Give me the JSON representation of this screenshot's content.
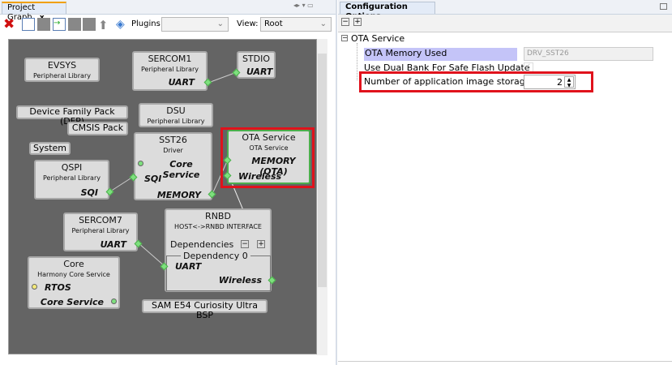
{
  "left_panel": {
    "tab": "Project Graph",
    "close": "x",
    "plugins_label": "Plugins:",
    "plugins_value": "",
    "view_label": "View:",
    "view_value": "Root",
    "toolbar": [
      "delete-icon",
      "add-component-icon",
      "component-icon",
      "import-icon",
      "component-icon",
      "component-icon",
      "up-arrow-icon",
      "center-icon"
    ]
  },
  "graph": {
    "evsys": {
      "title": "EVSYS",
      "sub": "Peripheral Library"
    },
    "sercom1": {
      "title": "SERCOM1",
      "sub": "Peripheral Library",
      "port": "UART"
    },
    "stdio": {
      "title": "STDIO",
      "port": "UART"
    },
    "dfp": "Device Family Pack (DFP)",
    "dsu": {
      "title": "DSU",
      "sub": "Peripheral Library"
    },
    "cmsis": "CMSIS Pack",
    "system": "System",
    "sst26": {
      "title": "SST26",
      "sub": "Driver",
      "p1": "Core Service",
      "p2": "SQI",
      "p3": "MEMORY"
    },
    "ota": {
      "title": "OTA Service",
      "sub": "OTA Service",
      "p1": "MEMORY (OTA)",
      "p2": "Wireless"
    },
    "qspi": {
      "title": "QSPI",
      "sub": "Peripheral Library",
      "port": "SQI"
    },
    "sercom7": {
      "title": "SERCOM7",
      "sub": "Peripheral Library",
      "port": "UART"
    },
    "rnbd": {
      "title": "RNBD",
      "sub": "HOST<->RNBD INTERFACE",
      "deps": "Dependencies",
      "dep0": "Dependency 0",
      "p1": "UART",
      "p2": "Wireless",
      "minus": "−",
      "plus": "+"
    },
    "core": {
      "title": "Core",
      "sub": "Harmony Core Service",
      "p1": "RTOS",
      "p2": "Core Service"
    },
    "bsp": "SAM E54 Curiosity Ultra BSP"
  },
  "right_panel": {
    "tab": "Configuration Options",
    "close": "x",
    "collapse": "−",
    "expand": "+",
    "tree": {
      "root": "OTA Service",
      "items": [
        {
          "label": "OTA Memory Used",
          "value": "DRV_SST26"
        },
        {
          "label": "Use Dual Bank For Safe Flash Update",
          "value": "checked"
        },
        {
          "label": "Number of application image storage",
          "value": "2"
        }
      ]
    }
  },
  "colors": {
    "highlight": "#e0121c",
    "port": "#7ee07e",
    "canvas": "#646464"
  }
}
